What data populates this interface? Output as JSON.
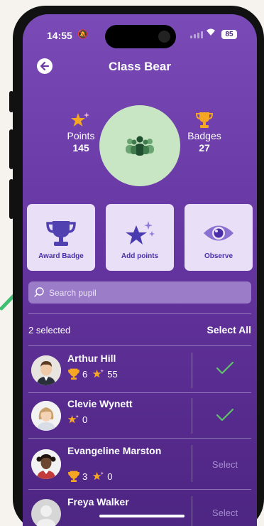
{
  "status_bar": {
    "time": "14:55",
    "battery": "85"
  },
  "header": {
    "title": "Class Bear"
  },
  "stats": {
    "points_label": "Points",
    "points_value": "145",
    "badges_label": "Badges",
    "badges_value": "27"
  },
  "actions": [
    {
      "label": "Award Badge",
      "icon": "trophy-icon"
    },
    {
      "label": "Add points",
      "icon": "stars-icon"
    },
    {
      "label": "Observe",
      "icon": "eye-icon"
    }
  ],
  "search": {
    "placeholder": "Search pupil"
  },
  "selection": {
    "count_text": "2 selected",
    "select_all": "Select All"
  },
  "pupils": [
    {
      "name": "Arthur Hill",
      "badges": "6",
      "points": "55",
      "selected": true
    },
    {
      "name": "Clevie Wynett",
      "points": "0",
      "selected": true
    },
    {
      "name": "Evangeline Marston",
      "badges": "3",
      "points": "0",
      "action": "Select"
    },
    {
      "name": "Freya Walker",
      "action": "Select"
    }
  ],
  "colors": {
    "accent": "#4a2ea8",
    "trophy": "#f5a623",
    "check": "#5fc36a"
  }
}
